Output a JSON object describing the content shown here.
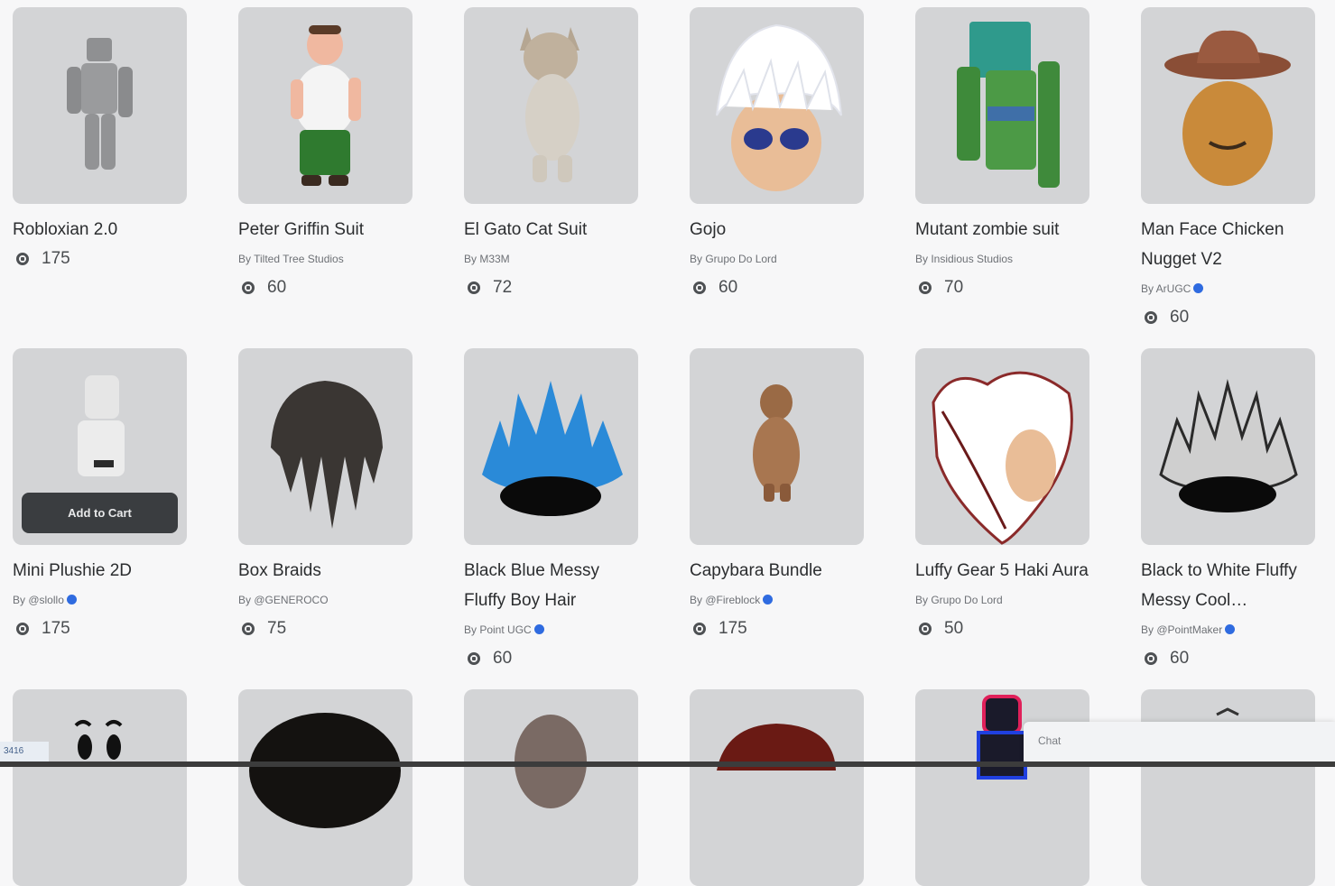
{
  "items": [
    {
      "name": "Robloxian 2.0",
      "creator": "",
      "verified": false,
      "price": "175"
    },
    {
      "name": "Peter Griffin Suit",
      "creator": "By Tilted Tree Studios",
      "verified": false,
      "price": "60"
    },
    {
      "name": "El Gato Cat Suit",
      "creator": "By M33M",
      "verified": false,
      "price": "72"
    },
    {
      "name": "Gojo",
      "creator": "By Grupo Do Lord",
      "verified": false,
      "price": "60"
    },
    {
      "name": "Mutant zombie suit",
      "creator": "By Insidious Studios",
      "verified": false,
      "price": "70"
    },
    {
      "name": "Man Face Chicken Nugget V2",
      "creator": "By ArUGC",
      "verified": true,
      "price": "60"
    },
    {
      "name": "Mini Plushie 2D",
      "creator": "By @slollo",
      "verified": true,
      "price": "175",
      "cart_label": "Add to Cart"
    },
    {
      "name": "Box Braids",
      "creator": "By @GENEROCO",
      "verified": false,
      "price": "75"
    },
    {
      "name": "Black Blue Messy Fluffy Boy Hair",
      "creator": "By Point UGC",
      "verified": true,
      "price": "60"
    },
    {
      "name": "Capybara Bundle",
      "creator": "By @Fireblock",
      "verified": true,
      "price": "175"
    },
    {
      "name": "Luffy Gear 5 Haki Aura",
      "creator": "By Grupo Do Lord",
      "verified": false,
      "price": "50"
    },
    {
      "name": "Black to White Fluffy Messy Cool…",
      "creator": "By @PointMaker",
      "verified": true,
      "price": "60"
    }
  ],
  "status_tag": "3416",
  "chat": {
    "label": "Chat"
  },
  "colors": {
    "thumb_bg": "#d3d4d6",
    "verified": "#2f6be0",
    "cart_button": "#3a3d40"
  }
}
